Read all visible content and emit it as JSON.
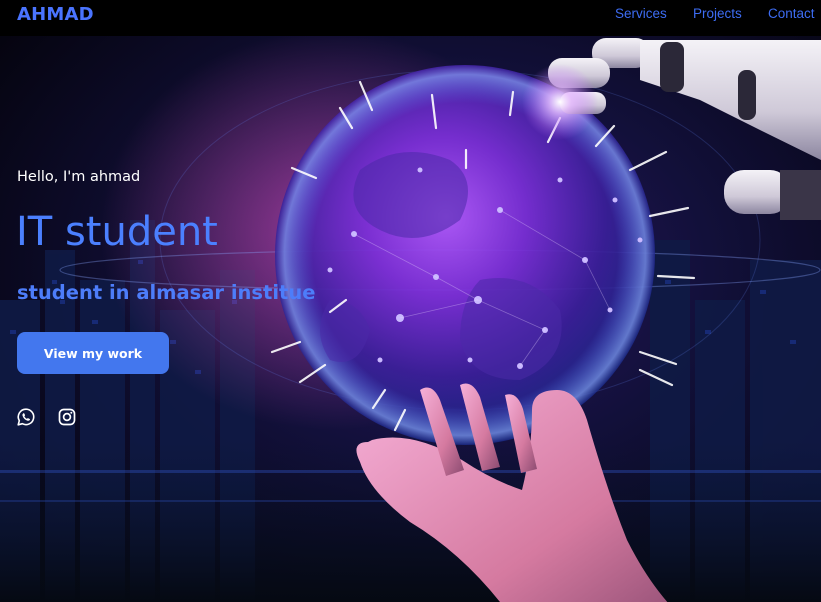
{
  "navbar": {
    "brand": "AHMAD",
    "links": [
      {
        "label": "Services"
      },
      {
        "label": "Projects"
      },
      {
        "label": "Contact"
      }
    ]
  },
  "hero": {
    "greeting": "Hello, I'm ahmad",
    "headline": "IT student",
    "subline": "student in almasar institue",
    "cta_label": "View my work",
    "social_icons": [
      "whatsapp-icon",
      "instagram-icon"
    ]
  },
  "colors": {
    "accent": "#4377ee",
    "brand": "#4a74ff",
    "nav_link": "#3d6cf2",
    "background": "#05030d"
  }
}
